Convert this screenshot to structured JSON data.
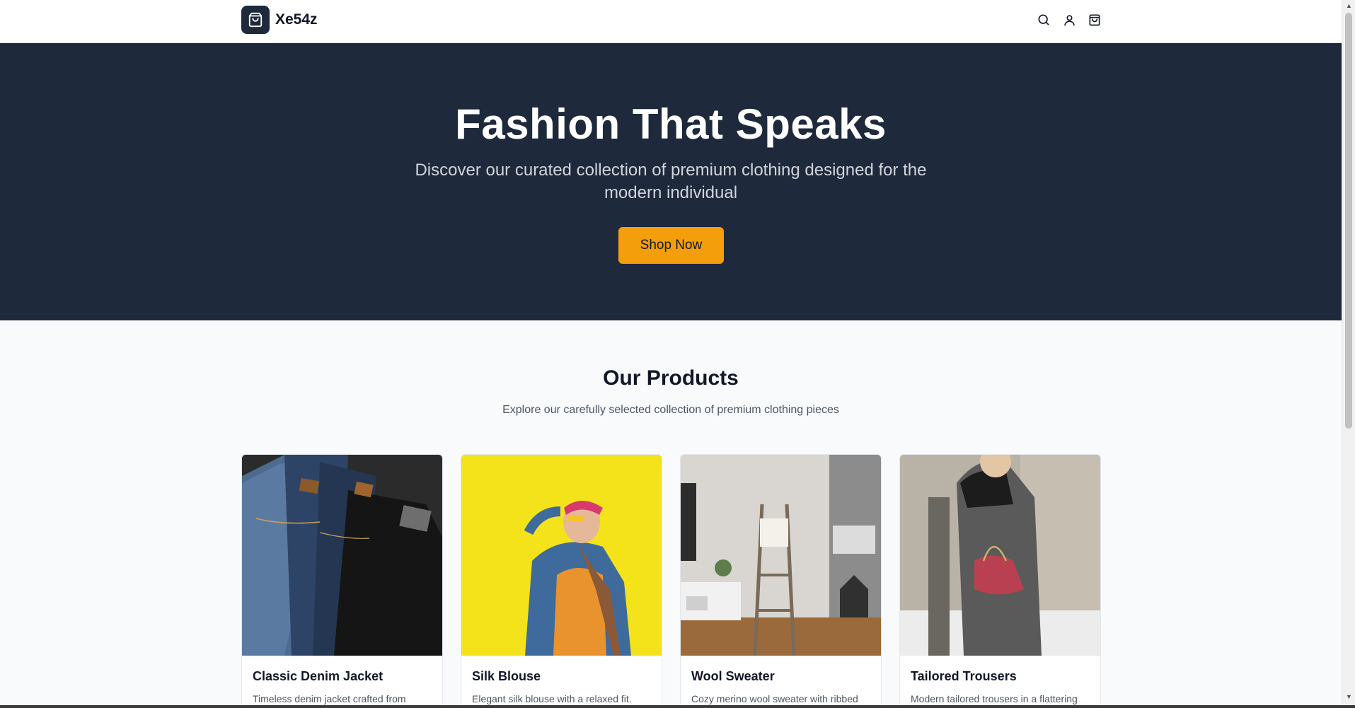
{
  "header": {
    "brand": "Xe54z",
    "icons": [
      "search-icon",
      "user-icon",
      "cart-icon"
    ]
  },
  "hero": {
    "title": "Fashion That Speaks",
    "subtitle": "Discover our curated collection of premium clothing designed for the modern individual",
    "cta": "Shop Now"
  },
  "products": {
    "title": "Our Products",
    "subtitle": "Explore our carefully selected collection of premium clothing pieces",
    "items": [
      {
        "name": "Classic Denim Jacket",
        "desc": "Timeless denim jacket crafted from"
      },
      {
        "name": "Silk Blouse",
        "desc": "Elegant silk blouse with a relaxed fit."
      },
      {
        "name": "Wool Sweater",
        "desc": "Cozy merino wool sweater with ribbed"
      },
      {
        "name": "Tailored Trousers",
        "desc": "Modern tailored trousers in a flattering"
      }
    ]
  },
  "colors": {
    "navy": "#1e293b",
    "accent": "#f59e0b",
    "background": "#f8fafc"
  }
}
